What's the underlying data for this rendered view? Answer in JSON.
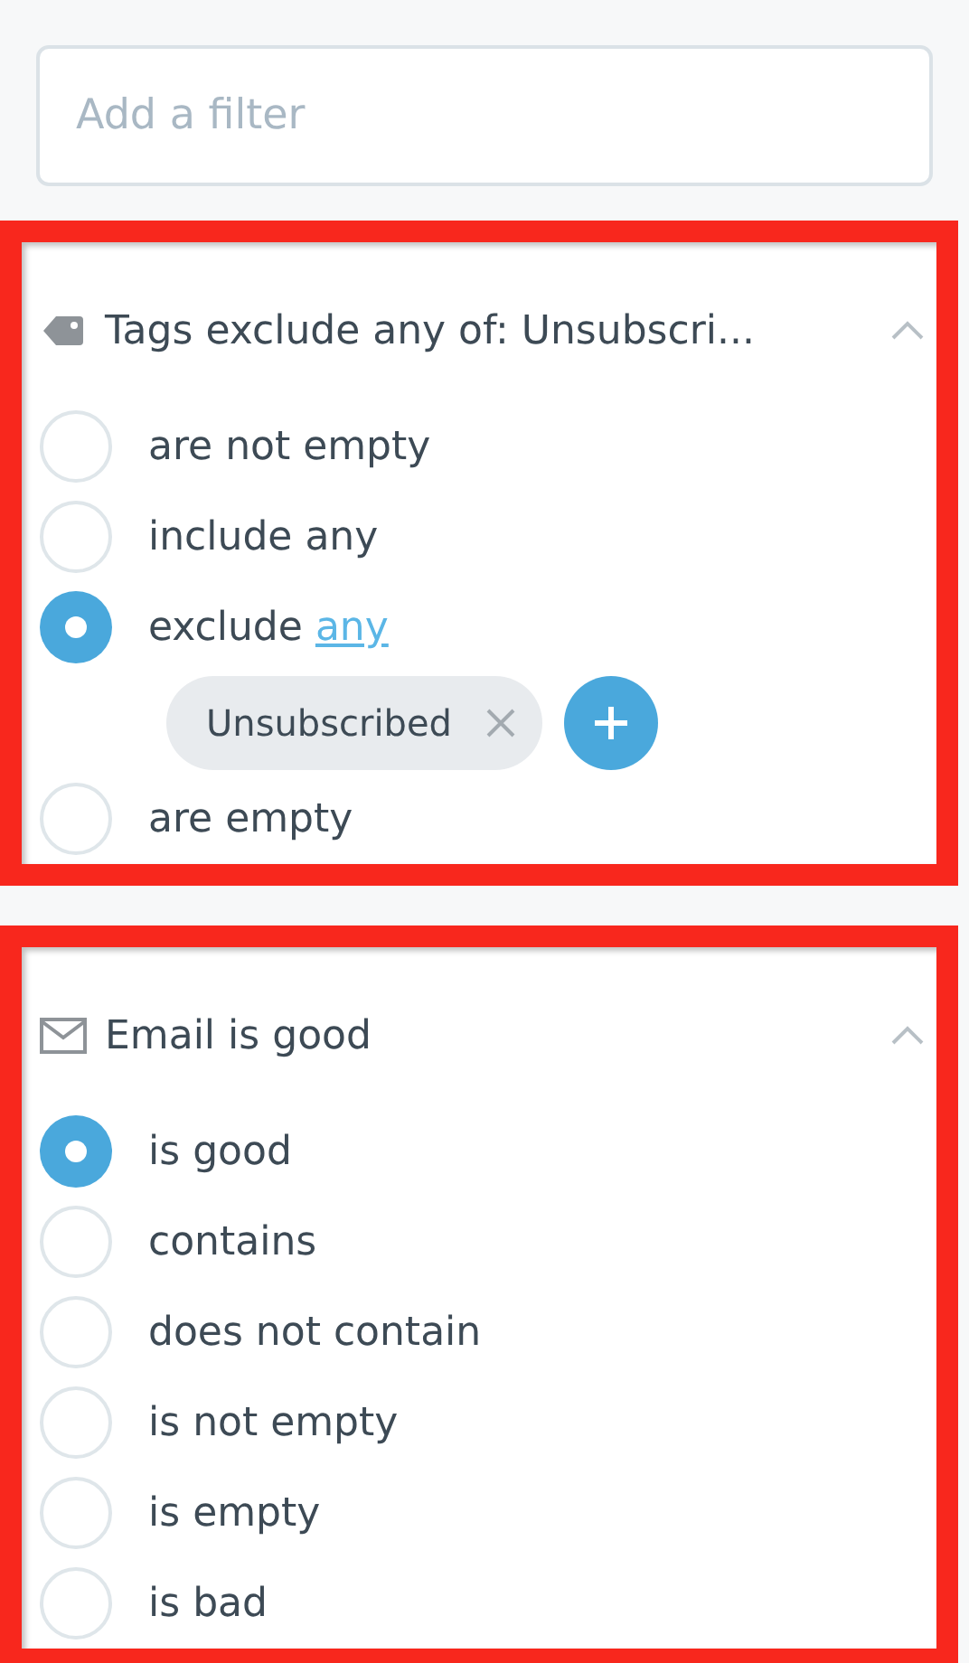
{
  "filter_field": {
    "placeholder": "Add a filter"
  },
  "filters": [
    {
      "kind": "tag",
      "title": "Tags exclude any of: Unsubscri...",
      "expanded": true,
      "options": [
        {
          "label": "are not empty",
          "selected": false
        },
        {
          "label": "include any",
          "selected": false
        },
        {
          "label": "exclude",
          "link": "any",
          "selected": true,
          "chips": [
            "Unsubscribed"
          ]
        },
        {
          "label": "are empty",
          "selected": false
        }
      ]
    },
    {
      "kind": "email",
      "title": "Email is good",
      "expanded": true,
      "options": [
        {
          "label": "is good",
          "selected": true
        },
        {
          "label": "contains",
          "selected": false
        },
        {
          "label": "does not contain",
          "selected": false
        },
        {
          "label": "is not empty",
          "selected": false
        },
        {
          "label": "is empty",
          "selected": false
        },
        {
          "label": "is bad",
          "selected": false
        }
      ]
    }
  ]
}
